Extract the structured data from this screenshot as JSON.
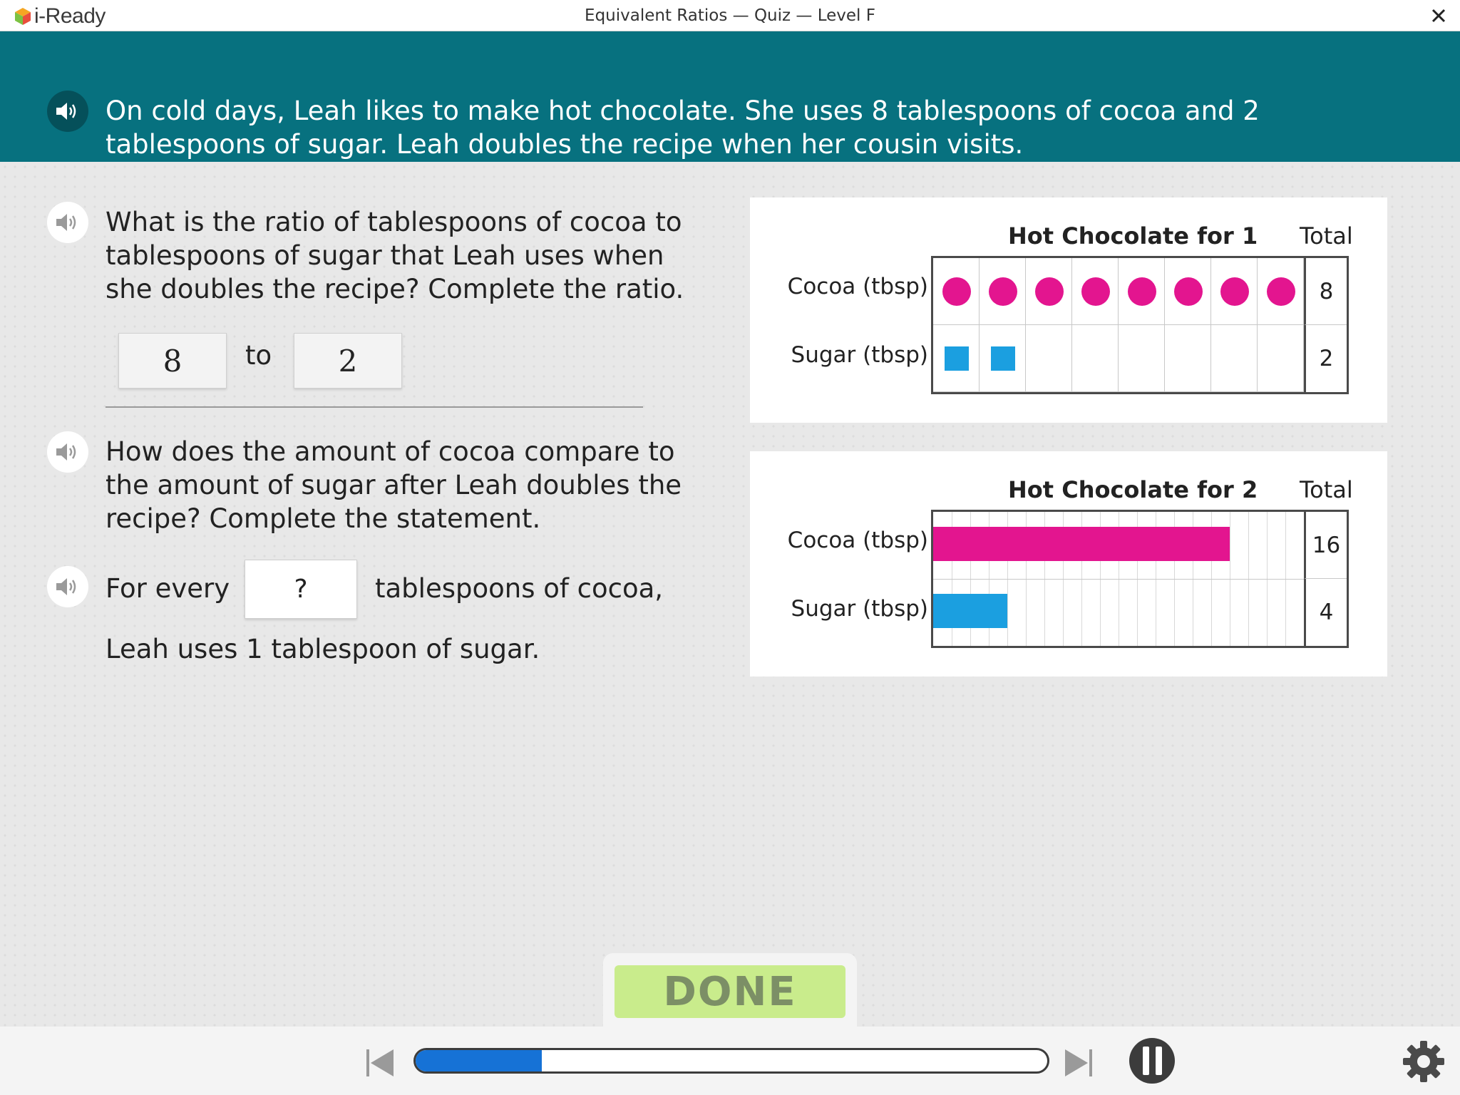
{
  "app": {
    "logo_text": "i-Ready",
    "window_title": "Equivalent Ratios — Quiz — Level F"
  },
  "banner": {
    "problem_text": "On cold days, Leah likes to make hot chocolate. She uses 8 tablespoons of cocoa and 2 tablespoons of sugar. Leah doubles the recipe when her cousin visits."
  },
  "question1": {
    "lines": [
      "What is the ratio of tablespoons of cocoa to",
      "tablespoons of sugar that Leah uses when",
      "she doubles the recipe? Complete the ratio."
    ],
    "ratio_left": "8",
    "ratio_word": "to",
    "ratio_right": "2"
  },
  "question2": {
    "lines": [
      "How does the amount of cocoa compare to",
      "the amount of sugar after Leah doubles the",
      "recipe? Complete the statement."
    ],
    "statement_prefix": "For every",
    "answer_value": "?",
    "statement_suffix": "tablespoons of cocoa,",
    "statement_line2": "Leah uses 1 tablespoon of sugar."
  },
  "chart_data": [
    {
      "type": "table",
      "title": "Hot Chocolate for 1",
      "total_header": "Total",
      "rows": [
        {
          "label": "Cocoa (tbsp)",
          "count": 8,
          "total": "8",
          "mark": "circle",
          "color": "#e3158f"
        },
        {
          "label": "Sugar (tbsp)",
          "count": 2,
          "total": "2",
          "mark": "square",
          "color": "#1b9fe0"
        }
      ],
      "columns": 8
    },
    {
      "type": "bar",
      "title": "Hot Chocolate for 2",
      "total_header": "Total",
      "rows": [
        {
          "label": "Cocoa (tbsp)",
          "value": 16,
          "total": "16",
          "color": "#e3158f"
        },
        {
          "label": "Sugar (tbsp)",
          "value": 4,
          "total": "4",
          "color": "#1b9fe0"
        }
      ],
      "max": 20
    }
  ],
  "done": {
    "label": "DONE"
  },
  "progress": {
    "fraction": 0.2
  },
  "colors": {
    "banner": "#07717f",
    "cocoa": "#e3158f",
    "sugar": "#1b9fe0",
    "done": "#c9ec8c",
    "progress": "#1672d6"
  }
}
